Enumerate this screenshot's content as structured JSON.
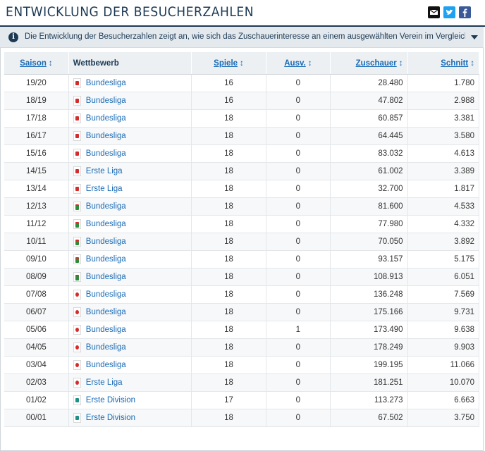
{
  "header": {
    "title": "ENTWICKLUNG DER BESUCHERZAHLEN",
    "share_icons": [
      "mail-icon",
      "twitter-icon",
      "facebook-icon"
    ]
  },
  "info": {
    "text": "Die Entwicklung der Besucherzahlen zeigt an, wie sich das Zuschauerinteresse an einem ausgewählten Verein im Vergleich der Saisons entwic…"
  },
  "table": {
    "columns": {
      "season": "Saison",
      "competition": "Wettbewerb",
      "games": "Spiele",
      "sold_out": "Ausv.",
      "spectators": "Zuschauer",
      "average": "Schnitt"
    },
    "sort_glyph": "↕",
    "rows": [
      {
        "season": "19/20",
        "competition": "Bundesliga",
        "logo": "red",
        "games": "16",
        "sold_out": "0",
        "spectators": "28.480",
        "average": "1.780"
      },
      {
        "season": "18/19",
        "competition": "Bundesliga",
        "logo": "red",
        "games": "16",
        "sold_out": "0",
        "spectators": "47.802",
        "average": "2.988"
      },
      {
        "season": "17/18",
        "competition": "Bundesliga",
        "logo": "red",
        "games": "18",
        "sold_out": "0",
        "spectators": "60.857",
        "average": "3.381"
      },
      {
        "season": "16/17",
        "competition": "Bundesliga",
        "logo": "red",
        "games": "18",
        "sold_out": "0",
        "spectators": "64.445",
        "average": "3.580"
      },
      {
        "season": "15/16",
        "competition": "Bundesliga",
        "logo": "red",
        "games": "18",
        "sold_out": "0",
        "spectators": "83.032",
        "average": "4.613"
      },
      {
        "season": "14/15",
        "competition": "Erste Liga",
        "logo": "red",
        "games": "18",
        "sold_out": "0",
        "spectators": "61.002",
        "average": "3.389"
      },
      {
        "season": "13/14",
        "competition": "Erste Liga",
        "logo": "red",
        "games": "18",
        "sold_out": "0",
        "spectators": "32.700",
        "average": "1.817"
      },
      {
        "season": "12/13",
        "competition": "Bundesliga",
        "logo": "green",
        "games": "18",
        "sold_out": "0",
        "spectators": "81.600",
        "average": "4.533"
      },
      {
        "season": "11/12",
        "competition": "Bundesliga",
        "logo": "green",
        "games": "18",
        "sold_out": "0",
        "spectators": "77.980",
        "average": "4.332"
      },
      {
        "season": "10/11",
        "competition": "Bundesliga",
        "logo": "green",
        "games": "18",
        "sold_out": "0",
        "spectators": "70.050",
        "average": "3.892"
      },
      {
        "season": "09/10",
        "competition": "Bundesliga",
        "logo": "green",
        "games": "18",
        "sold_out": "0",
        "spectators": "93.157",
        "average": "5.175"
      },
      {
        "season": "08/09",
        "competition": "Bundesliga",
        "logo": "green",
        "games": "18",
        "sold_out": "0",
        "spectators": "108.913",
        "average": "6.051"
      },
      {
        "season": "07/08",
        "competition": "Bundesliga",
        "logo": "redc",
        "games": "18",
        "sold_out": "0",
        "spectators": "136.248",
        "average": "7.569"
      },
      {
        "season": "06/07",
        "competition": "Bundesliga",
        "logo": "redc",
        "games": "18",
        "sold_out": "0",
        "spectators": "175.166",
        "average": "9.731"
      },
      {
        "season": "05/06",
        "competition": "Bundesliga",
        "logo": "redc",
        "games": "18",
        "sold_out": "1",
        "spectators": "173.490",
        "average": "9.638"
      },
      {
        "season": "04/05",
        "competition": "Bundesliga",
        "logo": "redc",
        "games": "18",
        "sold_out": "0",
        "spectators": "178.249",
        "average": "9.903"
      },
      {
        "season": "03/04",
        "competition": "Bundesliga",
        "logo": "redc",
        "games": "18",
        "sold_out": "0",
        "spectators": "199.195",
        "average": "11.066"
      },
      {
        "season": "02/03",
        "competition": "Erste Liga",
        "logo": "redc",
        "games": "18",
        "sold_out": "0",
        "spectators": "181.251",
        "average": "10.070"
      },
      {
        "season": "01/02",
        "competition": "Erste Division",
        "logo": "teal",
        "games": "17",
        "sold_out": "0",
        "spectators": "113.273",
        "average": "6.663"
      },
      {
        "season": "00/01",
        "competition": "Erste Division",
        "logo": "teal",
        "games": "18",
        "sold_out": "0",
        "spectators": "67.502",
        "average": "3.750"
      }
    ]
  }
}
